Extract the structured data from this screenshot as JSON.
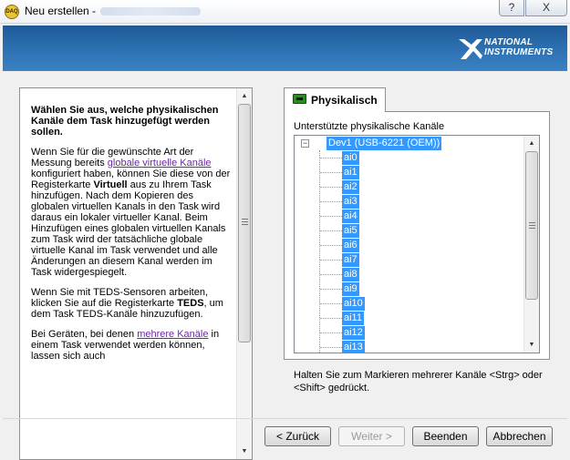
{
  "window": {
    "title": "Neu erstellen -",
    "help_label": "?",
    "close_label": "X",
    "app_icon_text": "DAQ"
  },
  "banner": {
    "logo_line1": "NATIONAL",
    "logo_line2": "INSTRUMENTS",
    "bg_color": "#2a6aab"
  },
  "help": {
    "heading": "Wählen Sie aus, welche physikalischen Kanäle dem Task hinzugefügt werden sollen.",
    "p2_a": "Wenn Sie für die gewünschte Art der Messung bereits ",
    "p2_link": "globale virtuelle Kanäle",
    "p2_b": " konfiguriert haben, können Sie diese von der Registerkarte ",
    "p2_bold": "Virtuell",
    "p2_c": " aus zu Ihrem Task hinzufügen. Nach dem Kopieren des globalen virtuellen Kanals in den Task wird daraus ein lokaler virtueller Kanal. Beim Hinzufügen eines globalen virtuellen Kanals zum Task wird der tatsächliche globale virtuelle Kanal im Task verwendet und alle Änderungen an diesem Kanal werden im Task widergespiegelt.",
    "p3_a": "Wenn Sie mit TEDS-Sensoren arbeiten, klicken Sie auf die Registerkarte ",
    "p3_bold": "TEDS",
    "p3_b": ", um dem Task TEDS-Kanäle hinzuzufügen.",
    "p4_a": "Bei Geräten, bei denen ",
    "p4_link": "mehrere Kanäle",
    "p4_b": " in einem Task verwendet werden können, lassen sich auch"
  },
  "tab": {
    "label": "Physikalisch"
  },
  "channels": {
    "label": "Unterstützte physikalische Kanäle",
    "device": "Dev1  (USB-6221 (OEM))",
    "items": [
      "ai0",
      "ai1",
      "ai2",
      "ai3",
      "ai4",
      "ai5",
      "ai6",
      "ai7",
      "ai8",
      "ai9",
      "ai10",
      "ai11",
      "ai12",
      "ai13"
    ],
    "selection_color": "#3399ff"
  },
  "hint": "Halten Sie zum Markieren mehrerer Kanäle <Strg> oder <Shift> gedrückt.",
  "buttons": {
    "back": "< Zurück",
    "next": "Weiter >",
    "finish": "Beenden",
    "cancel": "Abbrechen"
  }
}
